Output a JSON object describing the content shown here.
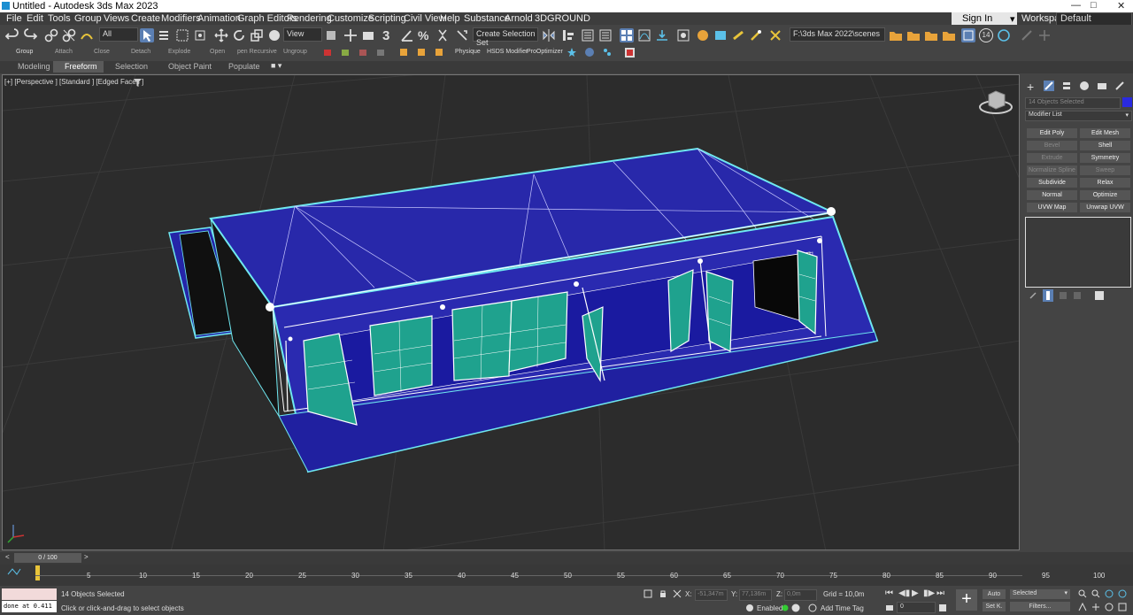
{
  "titlebar": {
    "title": "Untitled - Autodesk 3ds Max 2023"
  },
  "menu": [
    "File",
    "Edit",
    "Tools",
    "Group",
    "Views",
    "Create",
    "Modifiers",
    "Animation",
    "Graph Editors",
    "Rendering",
    "Customize",
    "Scripting",
    "Civil View",
    "Help",
    "Substance",
    "Arnold",
    "3DGROUND"
  ],
  "signin": "Sign In",
  "workspaces": {
    "label": "Workspaces:",
    "value": "Default"
  },
  "toolbar": {
    "filter": "All",
    "refcoord": "View",
    "selset": "Create Selection Set",
    "path": "F:\\3ds Max 2022\\scenes",
    "badge": "14"
  },
  "toolbar2": [
    "Group",
    "Attach",
    "Close",
    "Detach",
    "Explode",
    "Open",
    "pen Recursive",
    "Ungroup",
    "Physique",
    "HSDS Modifier",
    "ProOptimizer"
  ],
  "ribbon_tabs": [
    "Modeling",
    "Freeform",
    "Selection",
    "Object Paint",
    "Populate"
  ],
  "viewport": {
    "label": "[+] [Perspective ] [Standard ] [Edged Faces ]"
  },
  "cmdpanel": {
    "selection": "14 Objects Selected",
    "modlist": "Modifier List",
    "buttons": [
      {
        "l": "Edit Poly",
        "r": "Edit Mesh"
      },
      {
        "l": "Bevel",
        "r": "Shell"
      },
      {
        "l": "Extrude",
        "r": "Symmetry"
      },
      {
        "l": "Normalize Spline",
        "r": "Sweep"
      },
      {
        "l": "Subdivide",
        "r": "Relax"
      },
      {
        "l": "Normal",
        "r": "Optimize"
      },
      {
        "l": "UVW Map",
        "r": "Unwrap UVW"
      }
    ]
  },
  "timeslider": {
    "label": "0 / 100"
  },
  "ticks": [
    "5",
    "10",
    "15",
    "20",
    "25",
    "30",
    "35",
    "40",
    "45",
    "50",
    "55",
    "60",
    "65",
    "70",
    "75",
    "80",
    "85",
    "90",
    "95",
    "100"
  ],
  "status": {
    "script": "done at 0.411",
    "selected": "14 Objects Selected",
    "prompt": "Click or click-and-drag to select objects",
    "x_label": "X:",
    "x_val": "-51,347m",
    "y_label": "Y:",
    "y_val": "77,136m",
    "z_label": "Z:",
    "z_val": "0,0m",
    "grid": "Grid = 10,0m",
    "enabled": "Enabled:",
    "addtimetag": "Add Time Tag",
    "frame": "0",
    "auto": "Auto",
    "setk": "Set K.",
    "selmode": "Selected",
    "filters": "Filters..."
  }
}
